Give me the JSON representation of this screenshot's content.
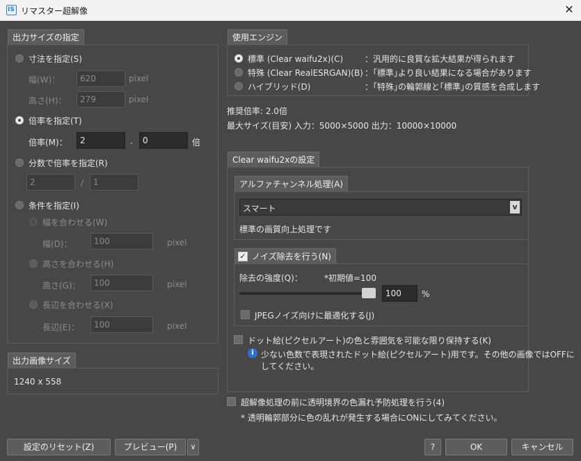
{
  "window": {
    "title": "リマスター超解像",
    "app_icon": "IS",
    "close": "✕"
  },
  "size_spec": {
    "tab": "出力サイズの指定",
    "by_dimension": {
      "label": "寸法を指定(S)",
      "width_label": "幅(W)：",
      "width_value": "620",
      "height_label": "高さ(H)：",
      "height_value": "279",
      "unit": "pixel"
    },
    "by_ratio": {
      "label": "倍率を指定(T)",
      "ratio_label": "倍率(M)：",
      "int_value": "2",
      "dot": ".",
      "dec_value": "0",
      "unit": "倍"
    },
    "by_fraction": {
      "label": "分数で倍率を指定(R)",
      "numerator": "2",
      "slash": "/",
      "denominator": "1"
    },
    "by_condition": {
      "label": "条件を指定(I)",
      "fit_width": {
        "label": "幅を合わせる(W)",
        "field_label": "幅(D)：",
        "value": "100",
        "unit": "pixel"
      },
      "fit_height": {
        "label": "高さを合わせる(H)",
        "field_label": "高さ(G)：",
        "value": "100",
        "unit": "pixel"
      },
      "fit_long": {
        "label": "長辺を合わせる(X)",
        "field_label": "長辺(E)：",
        "value": "100",
        "unit": "pixel"
      }
    }
  },
  "output_size": {
    "tab": "出力画像サイズ",
    "value": "1240 x 558"
  },
  "engine": {
    "tab": "使用エンジン",
    "options": [
      {
        "label": "標準 (Clear waifu2x)(C)",
        "desc": "：汎用的に良質な拡大結果が得られます"
      },
      {
        "label": "特殊 (Clear RealESRGAN)(B)",
        "desc": "：｢標準｣より良い結果になる場合があります"
      },
      {
        "label": "ハイブリッド(D)",
        "desc": "：｢特殊｣の輪郭線と｢標準｣の質感を合成します"
      }
    ],
    "recommended": "推奨倍率: 2.0倍",
    "max_size": "最大サイズ(目安) 入力：5000×5000 出力：10000×10000"
  },
  "waifu_settings": {
    "tab": "Clear waifu2xの設定",
    "alpha": {
      "tab": "アルファチャンネル処理(A)",
      "select_value": "スマート",
      "description": "標準の画質向上処理です"
    },
    "noise": {
      "tab": "ノイズ除去を行う(N)",
      "strength_label": "除去の強度(Q)：",
      "default_note": "*初期値=100",
      "value": "100",
      "unit": "%",
      "jpeg_label": "JPEGノイズ向けに最適化する(J)",
      "slider_level": 1.0
    },
    "dot_art": {
      "label": "ドット絵(ピクセルアート)の色と雰囲気を可能な限り保持する(K)",
      "info_line1": "少ない色数で表現されたドット絵(ピクセルアート)用です。その他の画像ではOFFに",
      "info_line2": "してください。"
    }
  },
  "prevent": {
    "label": "超解像処理の前に透明境界の色漏れ予防処理を行う(4)",
    "note": "* 透明輪郭部分に色の乱れが発生する場合にONにしてみてください。"
  },
  "buttons": {
    "reset": "設定のリセット(Z)",
    "preview": "プレビュー(P)",
    "preview_arrow": "∨",
    "help": "?",
    "ok": "OK",
    "cancel": "キャンセル"
  }
}
